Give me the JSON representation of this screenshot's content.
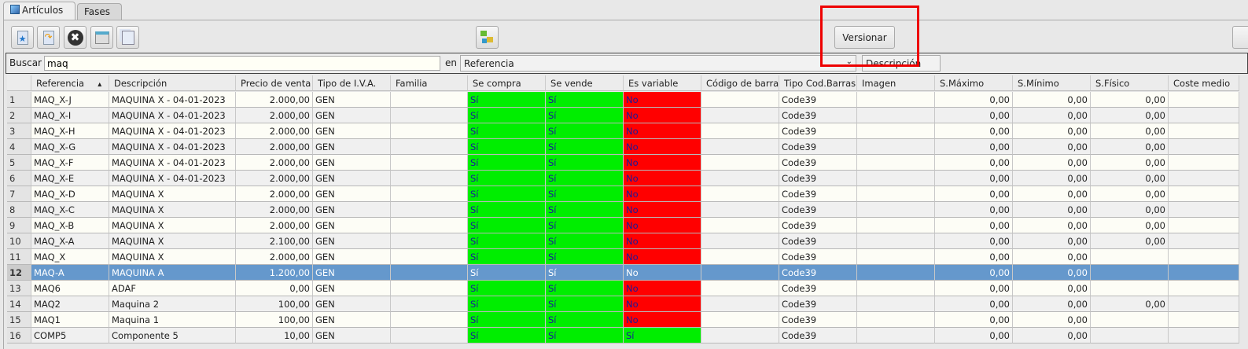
{
  "tabs": [
    {
      "label": "Artículos",
      "active": true
    },
    {
      "label": "Fases",
      "active": false
    }
  ],
  "toolbar": {
    "icons": [
      "new-document-icon",
      "edit-document-icon",
      "delete-icon",
      "preview-icon",
      "copy-icon"
    ],
    "center_icon": "tree-icon",
    "versionar_label": "Versionar"
  },
  "search": {
    "label": "Buscar",
    "value": "maq",
    "in_label": "en",
    "field_value": "Referencia",
    "second_field": "Descripción"
  },
  "colors": {
    "yes": "#00ee00",
    "no": "#ff0000",
    "selected": "#6598cc",
    "highlight": "#ff0000"
  },
  "columns": [
    "Referencia",
    "Descripción",
    "Precio de venta",
    "Tipo de I.V.A.",
    "Familia",
    "Se compra",
    "Se vende",
    "Es variable",
    "Código de barra",
    "Tipo Cod.Barras",
    "Imagen",
    "S.Máximo",
    "S.Mínimo",
    "S.Físico",
    "Coste medio"
  ],
  "sort_column": "Referencia",
  "selected_row": 12,
  "rows": [
    [
      "1",
      "MAQ_X-J",
      "MAQUINA X - 04-01-2023",
      "2.000,00",
      "GEN",
      "",
      "Sí",
      "Sí",
      "No",
      "",
      "Code39",
      "",
      "0,00",
      "0,00",
      "0,00",
      ""
    ],
    [
      "2",
      "MAQ_X-I",
      "MAQUINA X - 04-01-2023",
      "2.000,00",
      "GEN",
      "",
      "Sí",
      "Sí",
      "No",
      "",
      "Code39",
      "",
      "0,00",
      "0,00",
      "0,00",
      ""
    ],
    [
      "3",
      "MAQ_X-H",
      "MAQUINA X - 04-01-2023",
      "2.000,00",
      "GEN",
      "",
      "Sí",
      "Sí",
      "No",
      "",
      "Code39",
      "",
      "0,00",
      "0,00",
      "0,00",
      ""
    ],
    [
      "4",
      "MAQ_X-G",
      "MAQUINA X - 04-01-2023",
      "2.000,00",
      "GEN",
      "",
      "Sí",
      "Sí",
      "No",
      "",
      "Code39",
      "",
      "0,00",
      "0,00",
      "0,00",
      ""
    ],
    [
      "5",
      "MAQ_X-F",
      "MAQUINA X - 04-01-2023",
      "2.000,00",
      "GEN",
      "",
      "Sí",
      "Sí",
      "No",
      "",
      "Code39",
      "",
      "0,00",
      "0,00",
      "0,00",
      ""
    ],
    [
      "6",
      "MAQ_X-E",
      "MAQUINA X - 04-01-2023",
      "2.000,00",
      "GEN",
      "",
      "Sí",
      "Sí",
      "No",
      "",
      "Code39",
      "",
      "0,00",
      "0,00",
      "0,00",
      ""
    ],
    [
      "7",
      "MAQ_X-D",
      "MAQUINA X",
      "2.000,00",
      "GEN",
      "",
      "Sí",
      "Sí",
      "No",
      "",
      "Code39",
      "",
      "0,00",
      "0,00",
      "0,00",
      ""
    ],
    [
      "8",
      "MAQ_X-C",
      "MAQUINA X",
      "2.000,00",
      "GEN",
      "",
      "Sí",
      "Sí",
      "No",
      "",
      "Code39",
      "",
      "0,00",
      "0,00",
      "0,00",
      ""
    ],
    [
      "9",
      "MAQ_X-B",
      "MAQUINA X",
      "2.000,00",
      "GEN",
      "",
      "Sí",
      "Sí",
      "No",
      "",
      "Code39",
      "",
      "0,00",
      "0,00",
      "0,00",
      ""
    ],
    [
      "10",
      "MAQ_X-A",
      "MAQUINA X",
      "2.100,00",
      "GEN",
      "",
      "Sí",
      "Sí",
      "No",
      "",
      "Code39",
      "",
      "0,00",
      "0,00",
      "0,00",
      ""
    ],
    [
      "11",
      "MAQ_X",
      "MAQUINA X",
      "2.000,00",
      "GEN",
      "",
      "Sí",
      "Sí",
      "No",
      "",
      "Code39",
      "",
      "0,00",
      "0,00",
      "",
      ""
    ],
    [
      "12",
      "MAQ-A",
      "MAQUINA A",
      "1.200,00",
      "GEN",
      "",
      "Sí",
      "Sí",
      "No",
      "",
      "Code39",
      "",
      "0,00",
      "0,00",
      "",
      ""
    ],
    [
      "13",
      "MAQ6",
      "ADAF",
      "0,00",
      "GEN",
      "",
      "Sí",
      "Sí",
      "No",
      "",
      "Code39",
      "",
      "0,00",
      "0,00",
      "",
      ""
    ],
    [
      "14",
      "MAQ2",
      "Maquina 2",
      "100,00",
      "GEN",
      "",
      "Sí",
      "Sí",
      "No",
      "",
      "Code39",
      "",
      "0,00",
      "0,00",
      "0,00",
      ""
    ],
    [
      "15",
      "MAQ1",
      "Maquina 1",
      "100,00",
      "GEN",
      "",
      "Sí",
      "Sí",
      "No",
      "",
      "Code39",
      "",
      "0,00",
      "0,00",
      "",
      ""
    ],
    [
      "16",
      "COMP5",
      "Componente 5",
      "10,00",
      "GEN",
      "",
      "Sí",
      "Sí",
      "Sí",
      "",
      "Code39",
      "",
      "0,00",
      "0,00",
      "",
      ""
    ]
  ]
}
